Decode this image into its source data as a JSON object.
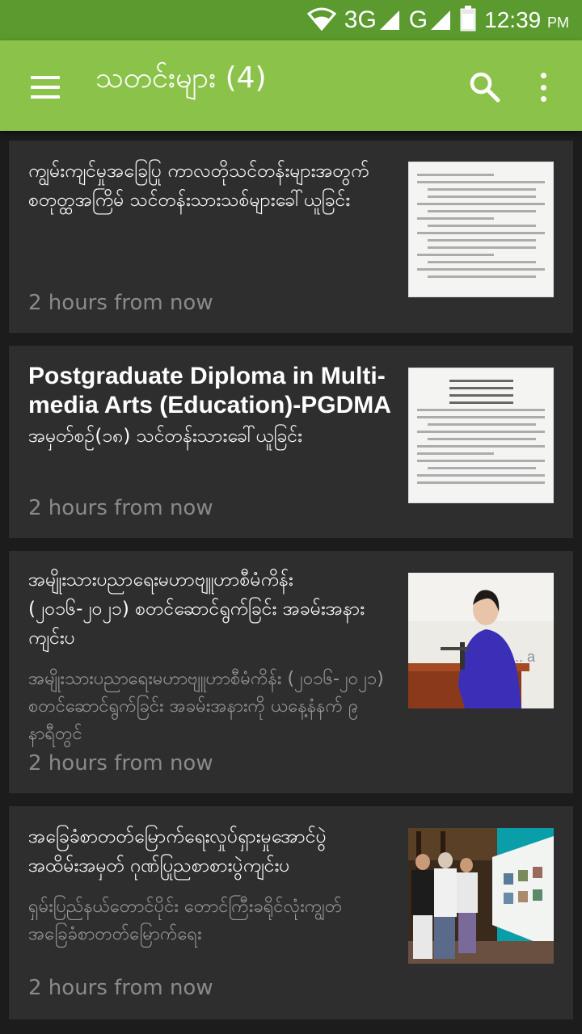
{
  "status_bar": {
    "network_3g": "3G",
    "network_g": "G",
    "time": "12:39",
    "ampm": "PM",
    "icons": [
      "wifi-icon",
      "signal-icon",
      "battery-icon"
    ]
  },
  "app_bar": {
    "title": "သတင်းများ (4)",
    "icons": [
      "menu-icon",
      "search-icon",
      "more-vert-icon"
    ]
  },
  "colors": {
    "status_bar": "#5a9a2e",
    "app_bar": "#8bc34a",
    "background": "#1c1c1c",
    "card": "#2e2e2e"
  },
  "articles": [
    {
      "title": "ကျွမ်းကျင်မှုအခြေပြု ကာလတိုသင်တန်းများအတွက် စတုတ္ထအကြိမ် သင်တန်းသားသစ်များခေါ်ယူခြင်း",
      "description": "",
      "time": "2 hours from now",
      "thumbnail": "document-scan"
    },
    {
      "title": "Postgraduate Diploma in Multi-media Arts (Education)-PGDMA",
      "subtitle": "အမှတ်စဉ်(၁၈) သင်တန်းသားခေါ်ယူခြင်း",
      "description": "",
      "time": "2 hours from now",
      "thumbnail": "document-scan"
    },
    {
      "title": " အမျိုးသားပညာရေးမဟာဗျူဟာစီမံကိန်း (၂၀၁၆-၂၀၂၁) စတင်ဆောင်ရွက်ခြင်း အခမ်းအနားကျင်းပ",
      "description": "အမျိုးသားပညာရေးမဟာဗျူဟာစီမံကိန်း (၂၀၁၆-၂၀၂၁) စတင်ဆောင်ရွက်ခြင်း အခမ်းအနားကို ယနေ့နံနက် ၉ နာရီတွင်",
      "time": "2 hours from now",
      "thumbnail": "speaker-photo"
    },
    {
      "title": "အခြေခံစာတတ်မြောက်ရေးလှုပ်ရှားမှုအောင်ပွဲအထိမ်းအမှတ် ဂုဏ်ပြုညစာစားပွဲကျင်းပ",
      "description": "ရှမ်းပြည်နယ်တောင်ပိုင်း တောင်ကြီးခရိုင်လုံးကျွတ် အခြေခံစာတတ်မြောက်ရေး",
      "time": "2 hours from now",
      "thumbnail": "exhibition-photo"
    }
  ]
}
